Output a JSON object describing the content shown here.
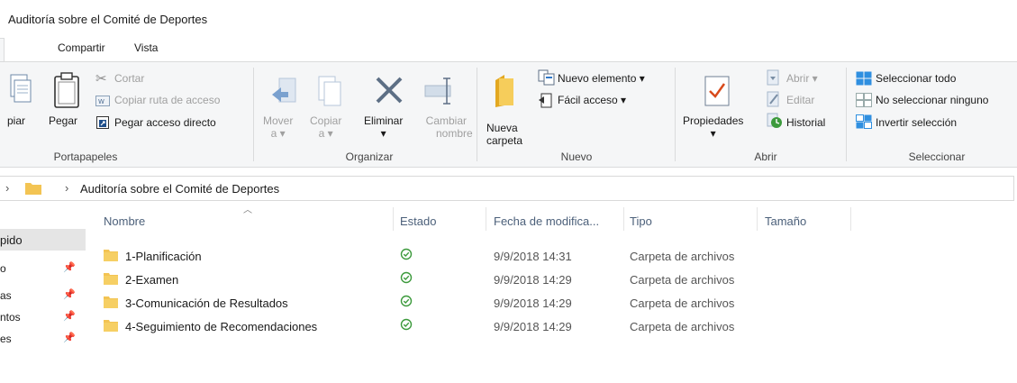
{
  "window": {
    "title": "Auditoría sobre el Comité de Deportes"
  },
  "tabs": [
    {
      "label": "Compartir"
    },
    {
      "label": "Vista"
    }
  ],
  "ribbon": {
    "portapapeles": {
      "label": "Portapapeles",
      "copiar": "piar",
      "pegar": "Pegar",
      "cortar": "Cortar",
      "copiar_ruta": "Copiar ruta de acceso",
      "pegar_acceso": "Pegar acceso directo"
    },
    "organizar": {
      "label": "Organizar",
      "mover_a": [
        "Mover",
        "a ▾"
      ],
      "copiar_a": [
        "Copiar",
        "a ▾"
      ],
      "eliminar": [
        "Eliminar",
        "▾"
      ],
      "cambiar_nombre": [
        "Cambiar",
        "nombre"
      ]
    },
    "nuevo": {
      "label": "Nuevo",
      "nueva_carpeta": [
        "Nueva",
        "carpeta"
      ],
      "nuevo_elemento": "Nuevo elemento ▾",
      "facil_acceso": "Fácil acceso ▾"
    },
    "abrir": {
      "label": "Abrir",
      "propiedades": [
        "Propiedades",
        "▾"
      ],
      "abrir": "Abrir ▾",
      "editar": "Editar",
      "historial": "Historial"
    },
    "seleccionar": {
      "label": "Seleccionar",
      "todo": "Seleccionar todo",
      "ninguno": "No seleccionar ninguno",
      "invertir": "Invertir selección"
    }
  },
  "address": {
    "path": "Auditoría sobre el Comité de Deportes",
    "separator": "›"
  },
  "nav": [
    {
      "label": "pido",
      "pinned": false,
      "selected": true
    },
    {
      "label": "o",
      "pinned": true
    },
    {
      "label": "as",
      "pinned": true
    },
    {
      "label": "ntos",
      "pinned": true
    },
    {
      "label": "es",
      "pinned": true
    }
  ],
  "columns": {
    "nombre": "Nombre",
    "estado": "Estado",
    "fecha": "Fecha de modifica...",
    "tipo": "Tipo",
    "tamano": "Tamaño"
  },
  "files": [
    {
      "name": "1-Planificación",
      "date": "9/9/2018 14:31",
      "type": "Carpeta de archivos",
      "size": ""
    },
    {
      "name": "2-Examen",
      "date": "9/9/2018 14:29",
      "type": "Carpeta de archivos",
      "size": ""
    },
    {
      "name": "3-Comunicación de Resultados",
      "date": "9/9/2018 14:29",
      "type": "Carpeta de archivos",
      "size": ""
    },
    {
      "name": "4-Seguimiento de Recomendaciones",
      "date": "9/9/2018 14:29",
      "type": "Carpeta de archivos",
      "size": ""
    }
  ],
  "colors": {
    "folder": "#f3c453",
    "status_ok": "#3c9a3c",
    "accent": "#1979ca"
  }
}
